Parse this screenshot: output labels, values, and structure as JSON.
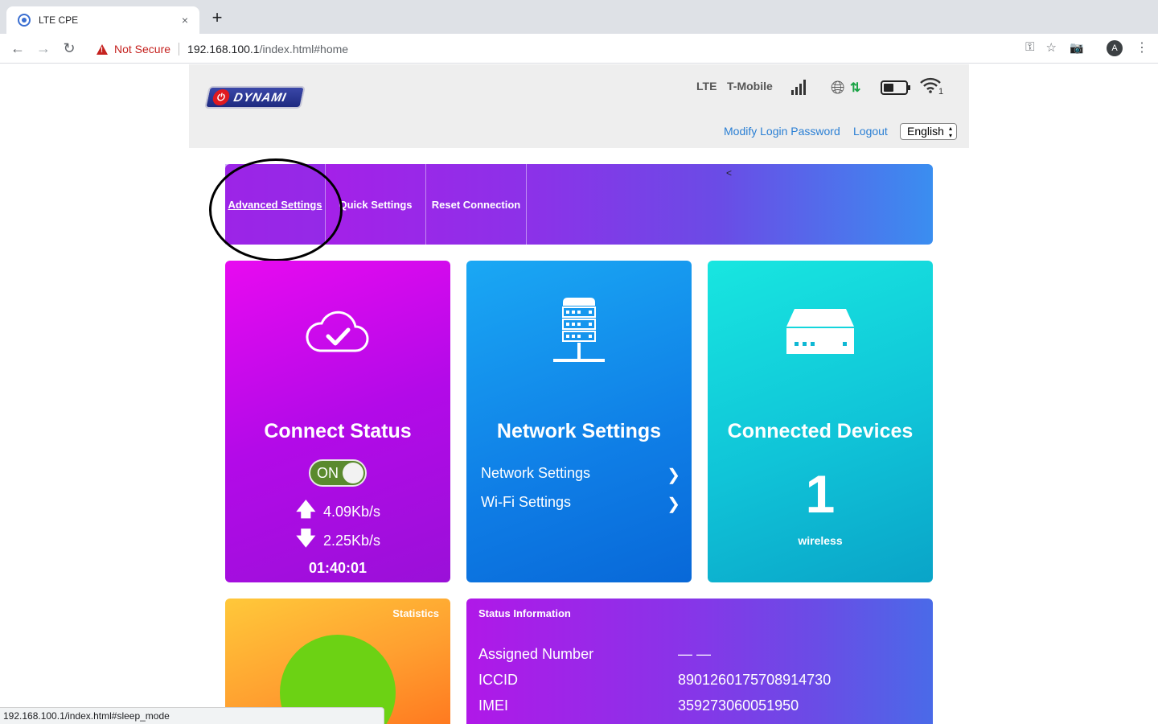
{
  "browser": {
    "tab_title": "LTE CPE",
    "tab_close": "×",
    "new_tab": "+",
    "security_label": "Not Secure",
    "url_host": "192.168.100.1",
    "url_path": "/index.html#home",
    "status_url": "192.168.100.1/index.html#sleep_mode",
    "avatar_letter": "A"
  },
  "header": {
    "logo_text": "DYNAMI",
    "network_type": "LTE",
    "carrier": "T-Mobile",
    "wifi_clients": "1",
    "links": {
      "modify_password": "Modify Login Password",
      "logout": "Logout"
    },
    "language": "English"
  },
  "menu": {
    "items": [
      {
        "label": "Advanced Settings",
        "active": true
      },
      {
        "label": "Quick Settings",
        "active": false
      },
      {
        "label": "Reset Connection",
        "active": false
      }
    ],
    "caret": "<"
  },
  "connect_status": {
    "title": "Connect Status",
    "toggle_label": "ON",
    "upload_speed": "4.09Kb/s",
    "download_speed": "2.25Kb/s",
    "uptime": "01:40:01"
  },
  "network_settings": {
    "title": "Network Settings",
    "links": [
      "Network Settings",
      "Wi-Fi Settings"
    ]
  },
  "connected_devices": {
    "title": "Connected Devices",
    "count": "1",
    "type": "wireless"
  },
  "statistics": {
    "title": "Statistics"
  },
  "status_information": {
    "title": "Status Information",
    "rows": [
      {
        "label": "Assigned Number",
        "value": "— —"
      },
      {
        "label": "ICCID",
        "value": "8901260175708914730"
      },
      {
        "label": "IMEI",
        "value": "359273060051950"
      }
    ]
  },
  "colors": {
    "accent_link": "#2a7fd4",
    "toggle_on": "#5a8a2e",
    "stats_pie": "#6cd214"
  }
}
